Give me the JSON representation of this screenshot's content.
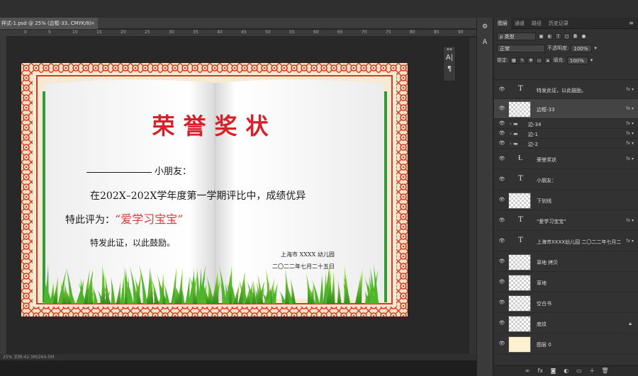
{
  "document": {
    "tab_label": "样式-1.psd @ 25% (边框-33, CMYK/8)",
    "status_text": "25%  文档:42.3M/264.5M"
  },
  "ruler_ticks": [
    "0",
    "5",
    "10",
    "15",
    "20",
    "25",
    "30",
    "35",
    "40",
    "45",
    "50",
    "55",
    "60",
    "65",
    "70",
    "75",
    "80",
    "85",
    "90"
  ],
  "certificate": {
    "title": "荣誉奖状",
    "addressee_suffix": "小朋友：",
    "body_line1": "在202X–202X学年度第一学期评比中，成绩优异",
    "body_line2_prefix": "特此评为：",
    "award_name": "“爱学习宝宝”",
    "closing": "特发此证，以此鼓励。",
    "issuer": "上海市 XXXX 幼儿园",
    "date": "二〇二二年七月二十五日",
    "colors": {
      "title": "#d8202a",
      "award": "#e03a3a",
      "border": "#d43a26",
      "grass": "#3fae2a"
    }
  },
  "mini_panel": {
    "icon1": "A|",
    "icon2": "¶"
  },
  "layers_panel": {
    "tabs": [
      "图层",
      "通道",
      "路径",
      "历史记录"
    ],
    "filter_label": "ρ 类型",
    "blend_mode": "正常",
    "opacity_label": "不透明度:",
    "opacity_value": "100%",
    "lock_label": "锁定:",
    "fill_label": "填充:",
    "fill_value": "100%",
    "layers": [
      {
        "name": "特发此证，以此鼓励。",
        "kind": "text",
        "fx": "fx"
      },
      {
        "name": "边框-33",
        "kind": "image",
        "fx": "fx"
      },
      {
        "name": "边-34",
        "kind": "group",
        "fx": "fx"
      },
      {
        "name": "边-1",
        "kind": "group",
        "fx": "fx"
      },
      {
        "name": "边-2",
        "kind": "group",
        "fx": "fx"
      },
      {
        "name": "荣誉奖状",
        "kind": "warp-text",
        "fx": "fx"
      },
      {
        "name": "小朋友：",
        "kind": "text",
        "fx": ""
      },
      {
        "name": "下划线",
        "kind": "image",
        "fx": ""
      },
      {
        "name": "\"爱学习宝宝\"",
        "kind": "text",
        "fx": "fx"
      },
      {
        "name": "上海市XXXX幼儿园 二〇二二年七月二...",
        "kind": "text",
        "fx": "fx"
      },
      {
        "name": "草地 拷贝",
        "kind": "smart",
        "fx": ""
      },
      {
        "name": "草地",
        "kind": "smart",
        "fx": ""
      },
      {
        "name": "空白书",
        "kind": "smart",
        "fx": ""
      },
      {
        "name": "底纹",
        "kind": "smart-locked",
        "fx": ""
      },
      {
        "name": "图层 0",
        "kind": "fill",
        "fx": ""
      }
    ]
  }
}
